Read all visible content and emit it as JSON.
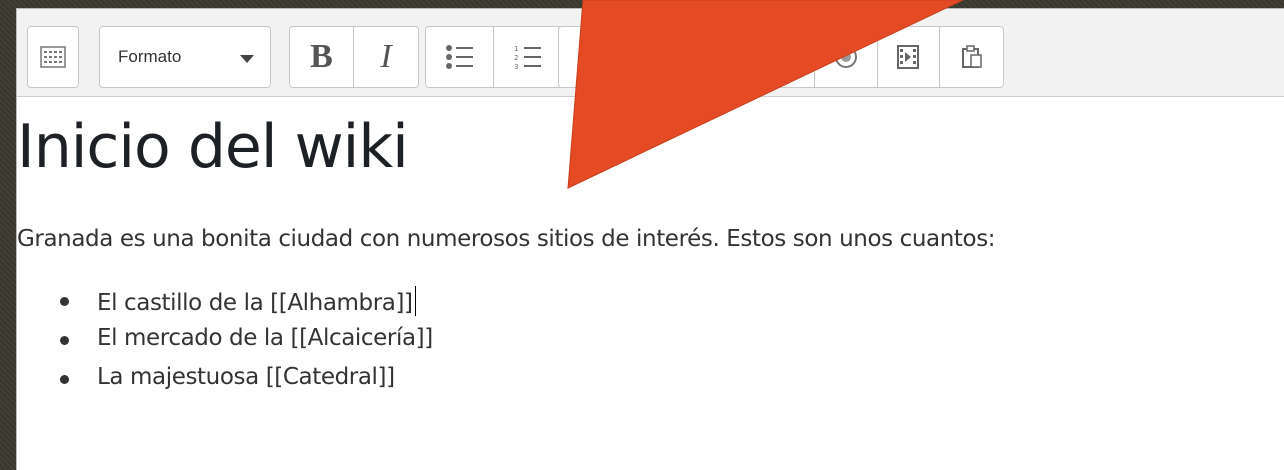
{
  "toolbar": {
    "format_label": "Formato",
    "bold_label": "B",
    "italic_label": "I"
  },
  "content": {
    "heading": "Inicio del wiki",
    "paragraph": "Granada es una bonita ciudad con numerosos sitios de interés. Estos son unos cuantos:",
    "list_items": [
      "El castillo de la [[Alhambra]]",
      "El mercado de la [[Alcaicería]]",
      "La majestuosa [[Catedral]]"
    ]
  },
  "icons": {
    "toggle": "toolbar-toggle-icon",
    "bullet_list": "unordered-list-icon",
    "numbered_list": "ordered-list-icon",
    "emoticon": "emoticon-icon",
    "media": "media-icon",
    "paste": "paste-icon"
  },
  "colors": {
    "arrow": "#e44a24",
    "heading": "#1d2125",
    "body_text": "#333333",
    "toolbar_bg": "#f2f2f2"
  }
}
